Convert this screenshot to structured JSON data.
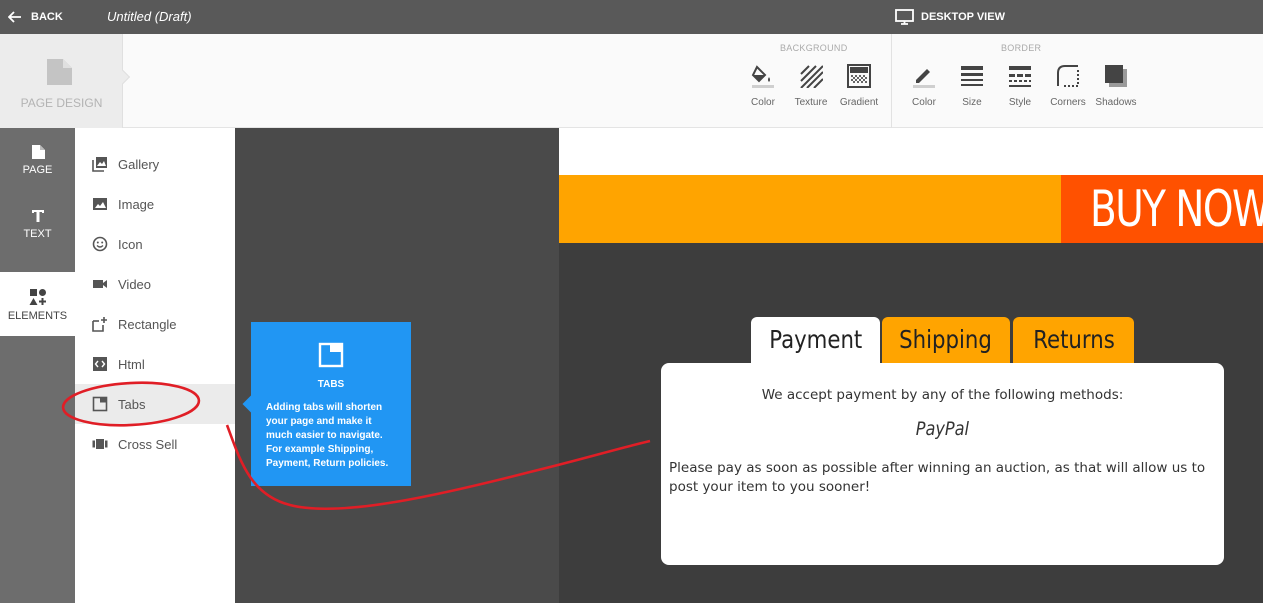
{
  "topbar": {
    "back_label": "BACK",
    "doc_title": "Untitled (Draft)",
    "view_label": "DESKTOP VIEW"
  },
  "toolbar": {
    "page_design_label": "PAGE DESIGN",
    "background": {
      "label": "BACKGROUND",
      "tools": [
        "Color",
        "Texture",
        "Gradient"
      ]
    },
    "border": {
      "label": "BORDER",
      "tools": [
        "Color",
        "Size",
        "Style",
        "Corners",
        "Shadows"
      ]
    }
  },
  "rail": {
    "items": [
      "PAGE",
      "TEXT",
      "ELEMENTS"
    ],
    "active": "ELEMENTS"
  },
  "elements": {
    "items": [
      "Gallery",
      "Image",
      "Icon",
      "Video",
      "Rectangle",
      "Html",
      "Tabs",
      "Cross Sell"
    ],
    "active": "Tabs"
  },
  "tooltip": {
    "title": "TABS",
    "body": "Adding tabs will shorten your page and make it much easier to navigate. For example Shipping, Payment, Return policies."
  },
  "canvas": {
    "buy_now": "BUY NOW",
    "tabs": [
      "Payment",
      "Shipping",
      "Returns"
    ],
    "active_tab": "Payment",
    "panel": {
      "accept_text": "We accept payment by any of the following methods:",
      "method": "PayPal",
      "note": "Please pay as soon as possible after winning an auction, as that will allow us to post your item to you sooner!"
    }
  },
  "colors": {
    "topbar": "#595959",
    "accent_blue": "#2196f3",
    "banner_orange": "#ffa400",
    "buy_now_orange": "#ff5100",
    "annotation_red": "#e01e26"
  },
  "icons": {
    "back": "arrow-left-icon",
    "desktop": "monitor-icon",
    "page_design": "page-icon"
  }
}
